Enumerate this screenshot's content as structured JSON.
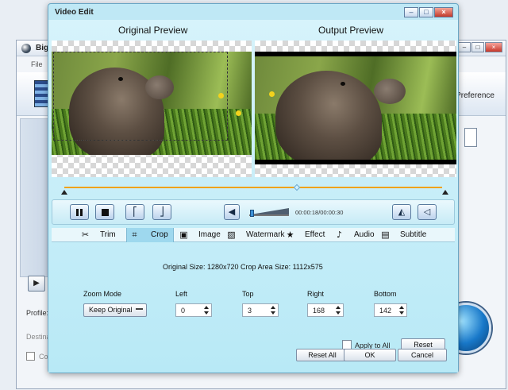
{
  "background": {
    "app_title": "Big",
    "menu_file": "File",
    "preference": "Preference",
    "profile_label": "Profile:",
    "destination_label": "Destina",
    "checkbox_label": "Co"
  },
  "dialog": {
    "title": "Video Edit",
    "original_preview": "Original Preview",
    "output_preview": "Output Preview"
  },
  "player": {
    "time": "00:00:18/00:00:30",
    "volume_level": 0.05
  },
  "tabs": [
    {
      "label": "Trim",
      "icon": "scissors-icon"
    },
    {
      "label": "Crop",
      "icon": "crop-icon",
      "active": true
    },
    {
      "label": "Image",
      "icon": "image-icon"
    },
    {
      "label": "Watermark",
      "icon": "watermark-icon"
    },
    {
      "label": "Effect",
      "icon": "star-icon"
    },
    {
      "label": "Audio",
      "icon": "music-note-icon"
    },
    {
      "label": "Subtitle",
      "icon": "subtitle-icon"
    }
  ],
  "crop": {
    "size_info": "Original Size: 1280x720  Crop Area Size: 1112x575",
    "zoom_mode_label": "Zoom Mode",
    "zoom_mode_value": "Keep Original",
    "left_label": "Left",
    "left_value": "0",
    "top_label": "Top",
    "top_value": "3",
    "right_label": "Right",
    "right_value": "168",
    "bottom_label": "Bottom",
    "bottom_value": "142",
    "apply_to_all": "Apply to All",
    "reset": "Reset"
  },
  "footer": {
    "reset_all": "Reset All",
    "ok": "OK",
    "cancel": "Cancel"
  }
}
